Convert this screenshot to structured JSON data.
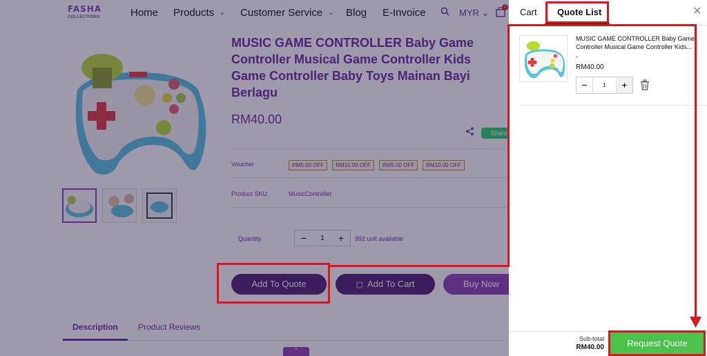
{
  "nav": {
    "logo_text": "FASHA",
    "logo_subtext": "COLLECTIONS",
    "items": [
      {
        "label": "Home"
      },
      {
        "label": "Products"
      },
      {
        "label": "Customer Service"
      },
      {
        "label": "Blog"
      },
      {
        "label": "E-Invoice"
      }
    ],
    "currency": "MYR",
    "cart_count": "1"
  },
  "product": {
    "title": "MUSIC GAME CONTROLLER Baby Game Controller Musical Game Controller Kids Game Controller Baby Toys Mainan Bayi Berlagu",
    "price": "RM40.00",
    "share_label": "Share",
    "voucher_label": "Voucher",
    "vouchers": [
      "RM5.00 OFF",
      "RM10.00 OFF",
      "RM5.00 OFF",
      "RM10.00 OFF"
    ],
    "sku_label": "Product SKU",
    "sku": "MusicController",
    "quantity_label": "Quantity",
    "quantity": "1",
    "available": "992 unit available",
    "add_to_quote": "Add To Quote",
    "add_to_cart": "Add To Cart",
    "buy_now": "Buy Now",
    "tabs": [
      "Description",
      "Product Reviews"
    ]
  },
  "drawer": {
    "tabs": [
      "Cart",
      "Quote List"
    ],
    "active_tab": "Quote List",
    "item": {
      "name": "MUSIC GAME CONTROLLER Baby Game Controller Musical Game Controller Kids...",
      "dot": ".",
      "price": "RM40.00",
      "quantity": "1"
    },
    "subtotal_label": "Sub-total",
    "subtotal": "RM40.00",
    "request_button": "Request Quote"
  },
  "colors": {
    "brand_purple": "#6b2a9e",
    "button_dark": "#4b1a6e",
    "accent_green": "#4cc24c",
    "annotation_red": "#e0141e"
  }
}
